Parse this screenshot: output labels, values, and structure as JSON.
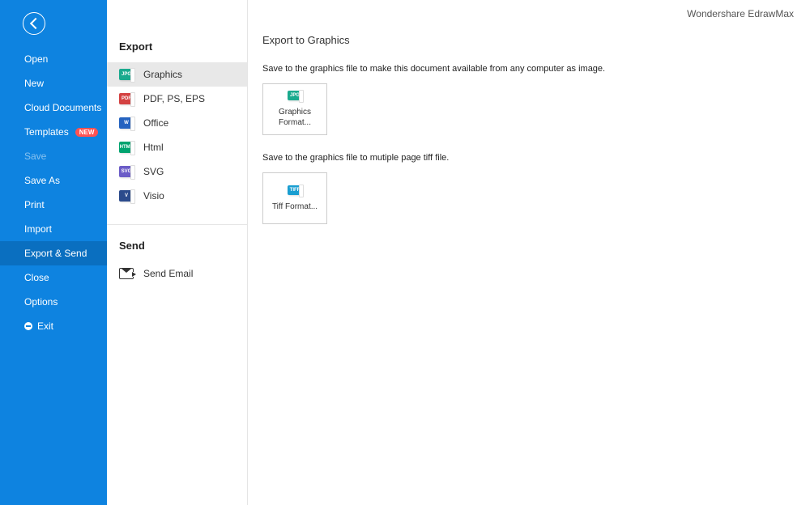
{
  "app": {
    "title": "Wondershare EdrawMax"
  },
  "sidebar": {
    "items": [
      {
        "label": "Open"
      },
      {
        "label": "New"
      },
      {
        "label": "Cloud Documents"
      },
      {
        "label": "Templates",
        "badge": "NEW"
      },
      {
        "label": "Save"
      },
      {
        "label": "Save As"
      },
      {
        "label": "Print"
      },
      {
        "label": "Import"
      },
      {
        "label": "Export & Send"
      },
      {
        "label": "Close"
      },
      {
        "label": "Options"
      },
      {
        "label": "Exit"
      }
    ]
  },
  "middle": {
    "export_header": "Export",
    "formats": [
      {
        "label": "Graphics",
        "icon": "JPG"
      },
      {
        "label": "PDF, PS, EPS",
        "icon": "PDF"
      },
      {
        "label": "Office",
        "icon": "W"
      },
      {
        "label": "Html",
        "icon": "HTML"
      },
      {
        "label": "SVG",
        "icon": "SVG"
      },
      {
        "label": "Visio",
        "icon": "V"
      }
    ],
    "send_header": "Send",
    "send_item": {
      "label": "Send Email"
    }
  },
  "content": {
    "title": "Export to Graphics",
    "desc1": "Save to the graphics file to make this document available from any computer as image.",
    "box1": {
      "icon": "JPG",
      "label": "Graphics Format..."
    },
    "desc2": "Save to the graphics file to mutiple page tiff file.",
    "box2": {
      "icon": "TIFF",
      "label": "Tiff Format..."
    }
  }
}
